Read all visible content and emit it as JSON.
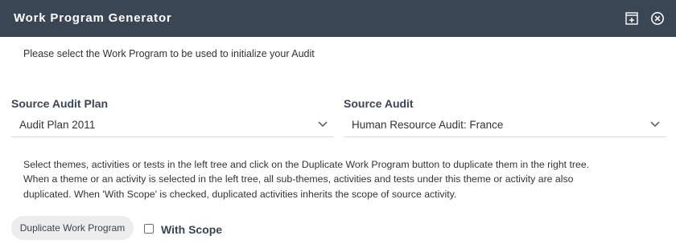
{
  "window": {
    "title": "Work Program Generator",
    "maximize_icon": "maximize-icon",
    "close_icon": "close-circle-icon",
    "titlebar_color": "#3a4654"
  },
  "intro_text": "Please select the Work Program to be used to initialize your Audit",
  "source_audit_plan": {
    "label": "Source Audit Plan",
    "value": "Audit Plan 2011"
  },
  "source_audit": {
    "label": "Source Audit",
    "value": "Human Resource Audit: France"
  },
  "help": {
    "line1": "Select themes, activities or tests in the left tree and click on the Duplicate Work Program button to duplicate them in the right tree.",
    "line2": "When a theme or an activity is selected in the left tree, all sub-themes, activities and tests under this theme or activity are also",
    "line3": "duplicated. When 'With Scope' is checked, duplicated activities inherits the scope of source activity."
  },
  "actions": {
    "duplicate_label": "Duplicate Work Program",
    "with_scope_label": "With Scope",
    "with_scope_checked": false
  }
}
